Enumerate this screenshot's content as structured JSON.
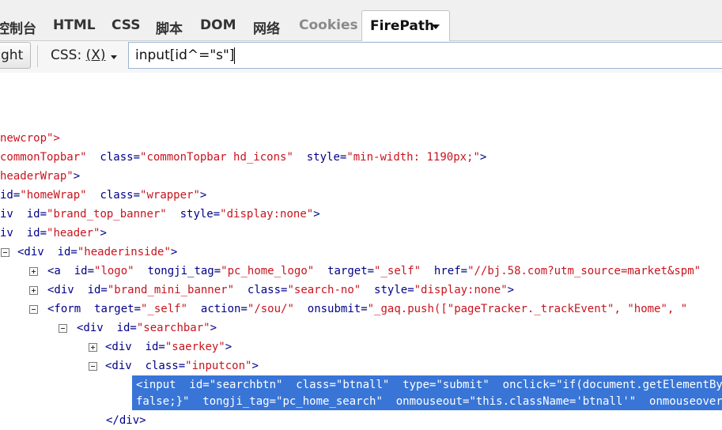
{
  "tabs": [
    {
      "label": "控制台",
      "dim": false
    },
    {
      "label": "HTML",
      "dim": false
    },
    {
      "label": "CSS",
      "dim": false
    },
    {
      "label": "脚本",
      "dim": false
    },
    {
      "label": "DOM",
      "dim": false
    },
    {
      "label": "网络",
      "dim": false
    },
    {
      "label": "Cookies",
      "dim": true
    },
    {
      "label": "FirePath",
      "dim": false,
      "active": true
    }
  ],
  "toolbar": {
    "highlight_label": "ght",
    "selector_type": "CSS: (X)",
    "selector_type_prefix": "CSS: ",
    "selector_type_key": "(X)",
    "query_value": "input[id^=\"s\"]"
  },
  "tree_rows": [
    {
      "toggle": "",
      "segments": [
        [
          "tg",
          "newcrop\">"
        ]
      ]
    },
    {
      "toggle": "",
      "segments": [
        [
          "av",
          "commonTopbar\""
        ],
        [
          "an",
          "  class="
        ],
        [
          "av",
          "\"commonTopbar hd_icons\""
        ],
        [
          "an",
          "  style="
        ],
        [
          "av",
          "\"min-width: 1190px;\""
        ],
        [
          "tg",
          ">"
        ]
      ]
    },
    {
      "toggle": "",
      "segments": [
        [
          "av",
          "headerWrap\""
        ],
        [
          "tg",
          ">"
        ]
      ]
    },
    {
      "toggle": "",
      "segments": [
        [
          "an",
          "id="
        ],
        [
          "av",
          "\"homeWrap\""
        ],
        [
          "an",
          "  class="
        ],
        [
          "av",
          "\"wrapper\""
        ],
        [
          "tg",
          ">"
        ]
      ]
    },
    {
      "toggle": "",
      "segments": [
        [
          "tg",
          "iv"
        ],
        [
          "an",
          "  id="
        ],
        [
          "av",
          "\"brand_top_banner\""
        ],
        [
          "an",
          "  style="
        ],
        [
          "av",
          "\"display:none\""
        ],
        [
          "tg",
          ">"
        ]
      ]
    },
    {
      "toggle": "",
      "segments": [
        [
          "tg",
          "iv"
        ],
        [
          "an",
          "  id="
        ],
        [
          "av",
          "\"header\""
        ],
        [
          "tg",
          ">"
        ]
      ]
    },
    {
      "toggle": "minus",
      "segments": [
        [
          "tg",
          "<div"
        ],
        [
          "an",
          "  id="
        ],
        [
          "av",
          "\"headerinside\""
        ],
        [
          "tg",
          ">"
        ]
      ]
    },
    {
      "toggle": "plus",
      "segments": [
        [
          "tg",
          "<a"
        ],
        [
          "an",
          "  id="
        ],
        [
          "av",
          "\"logo\""
        ],
        [
          "an",
          "  tongji_tag="
        ],
        [
          "av",
          "\"pc_home_logo\""
        ],
        [
          "an",
          "  target="
        ],
        [
          "av",
          "\"_self\""
        ],
        [
          "an",
          "  href="
        ],
        [
          "av",
          "\"//bj.58.com?utm_source=market&spm\""
        ]
      ]
    },
    {
      "toggle": "plus",
      "segments": [
        [
          "tg",
          "<div"
        ],
        [
          "an",
          "  id="
        ],
        [
          "av",
          "\"brand_mini_banner\""
        ],
        [
          "an",
          "  class="
        ],
        [
          "av",
          "\"search-no\""
        ],
        [
          "an",
          "  style="
        ],
        [
          "av",
          "\"display:none\""
        ],
        [
          "tg",
          ">"
        ]
      ]
    },
    {
      "toggle": "minus",
      "segments": [
        [
          "tg",
          "<form"
        ],
        [
          "an",
          "  target="
        ],
        [
          "av",
          "\"_self\""
        ],
        [
          "an",
          "  action="
        ],
        [
          "av",
          "\"/sou/\""
        ],
        [
          "an",
          "  onsubmit="
        ],
        [
          "av",
          "\"_gaq.push([\"pageTracker._trackEvent\", \"home\", \""
        ]
      ]
    },
    {
      "toggle": "minus",
      "segments": [
        [
          "tg",
          "<div"
        ],
        [
          "an",
          "  id="
        ],
        [
          "av",
          "\"searchbar\""
        ],
        [
          "tg",
          ">"
        ]
      ]
    },
    {
      "toggle": "plus",
      "segments": [
        [
          "tg",
          "<div"
        ],
        [
          "an",
          "  id="
        ],
        [
          "av",
          "\"saerkey\""
        ],
        [
          "tg",
          ">"
        ]
      ]
    },
    {
      "toggle": "minus",
      "segments": [
        [
          "tg",
          "<div"
        ],
        [
          "an",
          "  class="
        ],
        [
          "av",
          "\"inputcon\""
        ],
        [
          "tg",
          ">"
        ]
      ]
    },
    {
      "toggle": "",
      "selected": true,
      "segments": [
        [
          "tg",
          "<input"
        ],
        [
          "an",
          "  id="
        ],
        [
          "av",
          "\"searchbtn\""
        ],
        [
          "an",
          "  class="
        ],
        [
          "av",
          "\"btnall\""
        ],
        [
          "an",
          "  type="
        ],
        [
          "av",
          "\"submit\""
        ],
        [
          "an",
          "  onclick="
        ],
        [
          "av",
          "\"if(document.getElementById\""
        ]
      ]
    },
    {
      "toggle": "",
      "selected": true,
      "segments": [
        [
          "av",
          "false;}\""
        ],
        [
          "an",
          "  tongji_tag="
        ],
        [
          "av",
          "\"pc_home_search\""
        ],
        [
          "an",
          "  onmouseout="
        ],
        [
          "av",
          "\"this.className='btnall'\""
        ],
        [
          "an",
          "  onmouseover"
        ]
      ]
    },
    {
      "toggle": "",
      "segments": [
        [
          "tg",
          "</div>"
        ]
      ]
    }
  ],
  "colors": {
    "tag": "#000088",
    "attr_name": "#000088",
    "attr_value": "#c8141e",
    "selection": "#3875d7"
  }
}
